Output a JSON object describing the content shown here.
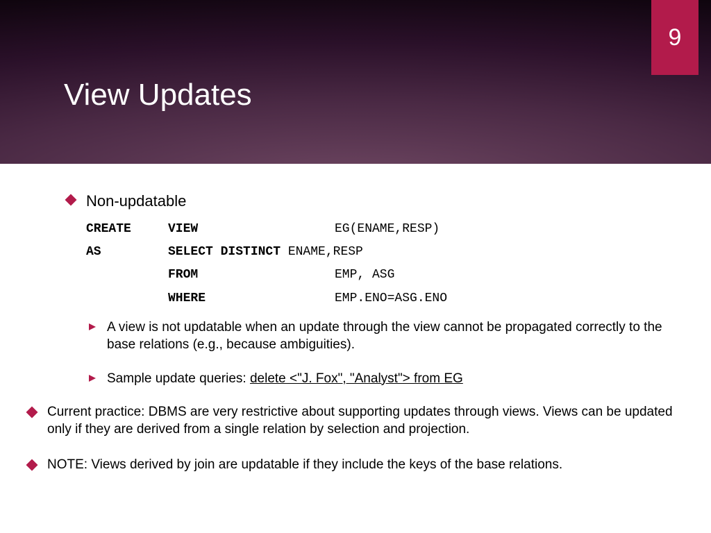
{
  "page_number": "9",
  "title": "View Updates",
  "section_heading": "Non-updatable",
  "code": {
    "r1": {
      "c1": "CREATE",
      "c2": "VIEW",
      "c3": "EG(ENAME,RESP)"
    },
    "r2": {
      "c1": "AS",
      "c2full": "SELECT DISTINCT ENAME,RESP",
      "c2a": "SELECT DISTINCT",
      "c2b": " ENAME,RESP"
    },
    "r3": {
      "c2": "FROM",
      "c3": "EMP, ASG"
    },
    "r4": {
      "c2": "WHERE",
      "c3": "EMP.ENO=ASG.ENO"
    }
  },
  "sub1": "A view is not updatable when an update through the view cannot be propagated correctly to the base relations (e.g., because ambiguities).",
  "sub2_lead": "Sample update queries: ",
  "sub2_underlined": "delete <\"J. Fox\", \"Analyst\"> from EG",
  "bullet2": "Current practice: DBMS are very restrictive about supporting updates through views. Views can be updated only if they are derived from a single relation by selection and projection.",
  "bullet3": "NOTE:  Views derived by join are updatable if they include the keys of the base relations."
}
